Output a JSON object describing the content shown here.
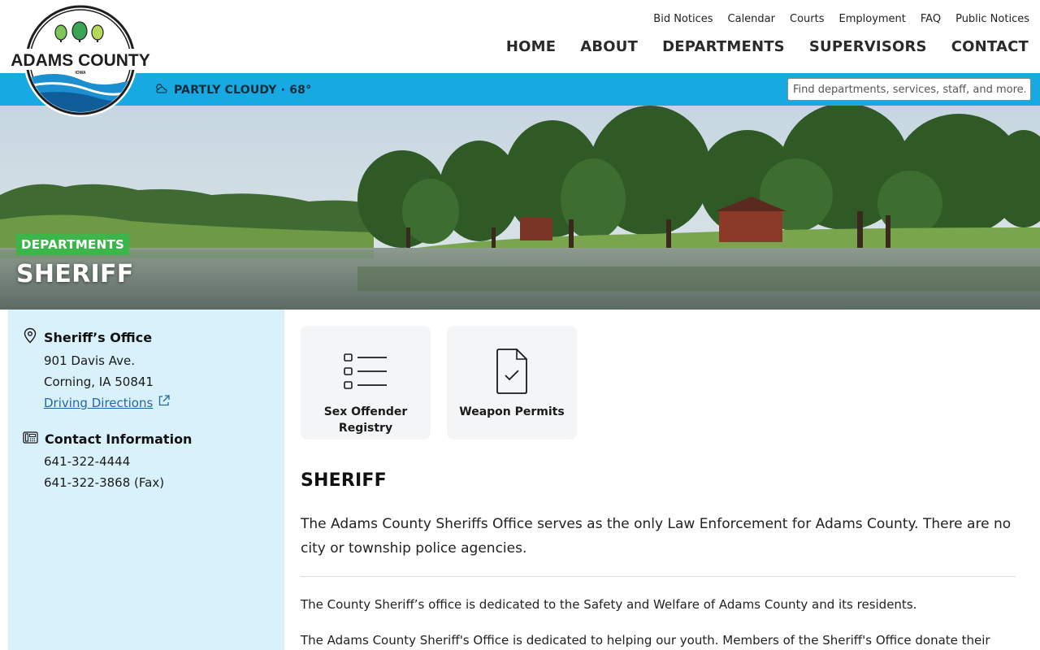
{
  "logo": {
    "name": "ADAMS COUNTY",
    "subtitle": "IOWA"
  },
  "utility_nav": [
    "Bid Notices",
    "Calendar",
    "Courts",
    "Employment",
    "FAQ",
    "Public Notices"
  ],
  "main_nav": [
    "HOME",
    "ABOUT",
    "DEPARTMENTS",
    "SUPERVISORS",
    "CONTACT"
  ],
  "weather": {
    "text": "PARTLY CLOUDY · 68°",
    "icon": "partly-cloudy-icon"
  },
  "search": {
    "placeholder": "Find departments, services, staff, and more..."
  },
  "hero": {
    "tag": "DEPARTMENTS",
    "title": "SHERIFF"
  },
  "sidebar": {
    "office": {
      "title": "Sheriff’s Office",
      "address_line1": "901 Davis Ave.",
      "address_line2": "Corning, IA 50841",
      "directions_label": "Driving Directions",
      "icon": "map-pin-icon"
    },
    "contact": {
      "title": "Contact Information",
      "phone": "641-322-4444",
      "fax": "641-322-3868 (Fax)",
      "icon": "phone-fax-icon"
    }
  },
  "cards": [
    {
      "label": "Sex Offender Registry",
      "icon": "list-icon"
    },
    {
      "label": "Weapon Permits",
      "icon": "document-check-icon"
    }
  ],
  "main": {
    "title": "SHERIFF",
    "lead": "The Adams County Sheriffs Office serves as the only Law Enforcement for Adams County. There are no city or township police agencies.",
    "paragraphs": [
      "The County Sheriff’s office is dedicated to the Safety and Welfare of Adams County and its residents.",
      "The Adams County Sheriff's Office is dedicated to helping our youth. Members of the Sheriff's Office donate their time"
    ]
  },
  "colors": {
    "blue_bar": "#17a9e1",
    "tag_green": "#3cb54a",
    "sidebar_bg": "#d9f1fb",
    "link": "#1f67a8"
  }
}
